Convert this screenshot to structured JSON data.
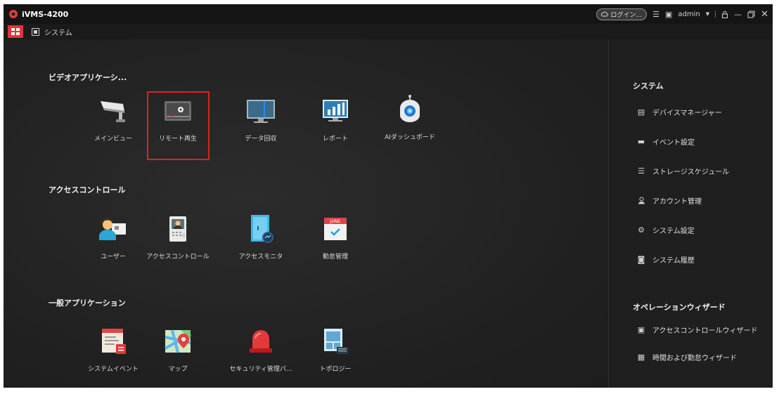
{
  "window": {
    "title": "iVMS-4200",
    "login_label": "ログイン...",
    "user_name": "admin",
    "colors": {
      "titlebar": "#151515",
      "main_bg": "#232323",
      "accent": "#e8313a",
      "highlight": "#e02020"
    }
  },
  "nav": {
    "home_icon": "grid-icon",
    "system_tab_label": "システム"
  },
  "sections": {
    "video": {
      "title": "ビデオアプリケーシ...",
      "apps": [
        {
          "label": "メインビュー",
          "icon": "camera-icon"
        },
        {
          "label": "リモート再生",
          "icon": "playback-icon",
          "highlighted": true
        },
        {
          "label": "データ回収",
          "icon": "monitor-icon"
        },
        {
          "label": "レポート",
          "icon": "report-chart-icon"
        },
        {
          "label": "AIダッシュボード",
          "icon": "ai-robot-icon"
        }
      ]
    },
    "access": {
      "title": "アクセスコントロール",
      "apps": [
        {
          "label": "ユーザー",
          "icon": "user-card-icon"
        },
        {
          "label": "アクセスコントロール",
          "icon": "intercom-icon"
        },
        {
          "label": "アクセスモニタ",
          "icon": "door-monitor-icon"
        },
        {
          "label": "勤怠管理",
          "icon": "calendar-icon"
        }
      ]
    },
    "general": {
      "title": "一般アプリケーション",
      "apps": [
        {
          "label": "システムイベント",
          "icon": "event-list-icon"
        },
        {
          "label": "マップ",
          "icon": "map-pin-icon"
        },
        {
          "label": "セキュリティ管理パ...",
          "icon": "alarm-light-icon"
        },
        {
          "label": "トポロジー",
          "icon": "topology-icon"
        }
      ]
    }
  },
  "right_panel": {
    "system": {
      "title": "システム",
      "items": [
        {
          "label": "デバイスマネージャー",
          "icon": "device-manager-icon"
        },
        {
          "label": "イベント設定",
          "icon": "event-config-icon"
        },
        {
          "label": "ストレージスケジュール",
          "icon": "storage-icon"
        },
        {
          "label": "アカウント管理",
          "icon": "account-icon"
        },
        {
          "label": "システム設定",
          "icon": "gear-icon"
        },
        {
          "label": "システム履歴",
          "icon": "log-icon"
        }
      ]
    },
    "wizard": {
      "title": "オペレーションウィザード",
      "items": [
        {
          "label": "アクセスコントロールウィザード",
          "icon": "wizard-doc-icon"
        },
        {
          "label": "時間および勤怠ウィザード",
          "icon": "wizard-calendar-icon"
        }
      ]
    }
  }
}
